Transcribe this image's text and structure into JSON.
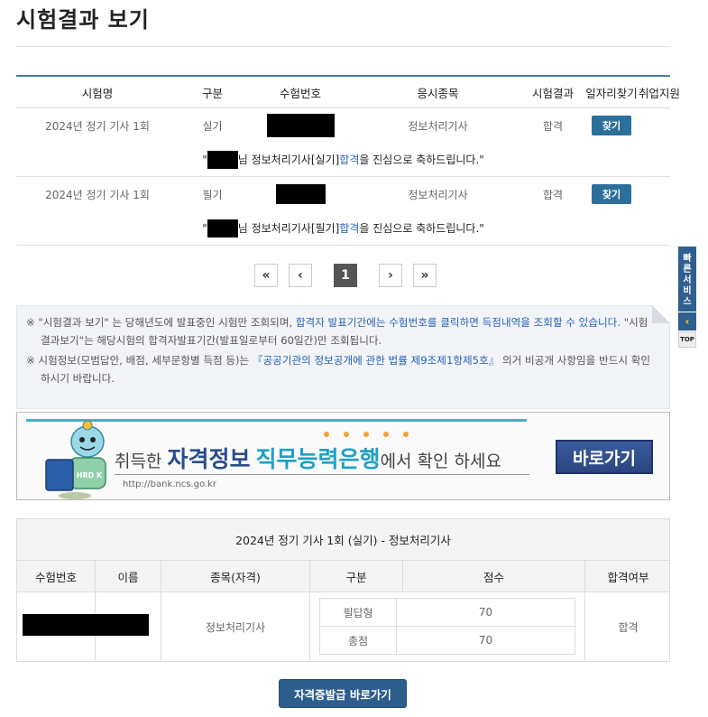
{
  "page": {
    "title": "시험결과 보기"
  },
  "results": {
    "columns": [
      "시험명",
      "구분",
      "수험번호",
      "응시종목",
      "시험결과",
      "일자리찾기",
      "취업지원"
    ],
    "rows": [
      {
        "exam": "2024년 정기 기사 1회",
        "type": "실기",
        "subject": "정보처리기사",
        "result": "합격",
        "find_label": "찾기",
        "congrats": {
          "open_quote": "\"",
          "pre": "님 정보처리기사[실기] ",
          "highlight": "합격",
          "post": "을 진심으로 축하드립니다.\""
        }
      },
      {
        "exam": "2024년 정기 기사 1회",
        "type": "필기",
        "subject": "정보처리기사",
        "result": "합격",
        "find_label": "찾기",
        "congrats": {
          "open_quote": "\"",
          "pre": "님 정보처리기사[필기] ",
          "highlight": "합격",
          "post": "을 진심으로 축하드립니다.\""
        }
      }
    ]
  },
  "pagination": {
    "first": "«",
    "prev": "‹",
    "current": "1",
    "next": "›",
    "last": "»"
  },
  "notice": {
    "line1_a": "※ \"시험결과 보기\" 는 당해년도에 발표중인 시험만 조회되며, ",
    "line1_blue": "합격자 발표기간에는 수험번호를 클릭하면 득점내역을 조회할 수 있습니다.",
    "line1_b": " \"시험결과보기\"는 해당시험의 합격자발표기간(발표일로부터 60일간)만 조회됩니다.",
    "line2_a": "※ 시험정보(모범답안, 배점, 세부문항별 득점 등)는 ",
    "line2_blue": "『공공기관의 정보공개에 관한 법률 제9조제1항제5호』",
    "line2_b": " 의거 비공개 사항임을 반드시 확인하시기 바랍니다."
  },
  "banner": {
    "pre": "취득한 ",
    "strong1": "자격정보",
    "strong2": "직무능력은행",
    "post": "에서 확인 하세요",
    "url": "http://bank.ncs.go.kr",
    "button": "바로가기",
    "mascot_badge": "HRD K"
  },
  "detail": {
    "title": "2024년 정기 기사 1회 (실기) - 정보처리기사",
    "columns": [
      "수험번호",
      "이름",
      "종목(자격)",
      "구분",
      "점수",
      "합격여부"
    ],
    "subject": "정보처리기사",
    "scores": [
      {
        "label": "필답형",
        "value": "70"
      },
      {
        "label": "총점",
        "value": "70"
      }
    ],
    "pass": "합격"
  },
  "issue_button": "자격증발급 바로가기",
  "quick": {
    "label": "빠른서비스",
    "toggle": "‹",
    "top": "TOP"
  },
  "colors": {
    "accent": "#2c6f9a",
    "table_top": "#4c7ca8",
    "link": "#2262b8"
  }
}
